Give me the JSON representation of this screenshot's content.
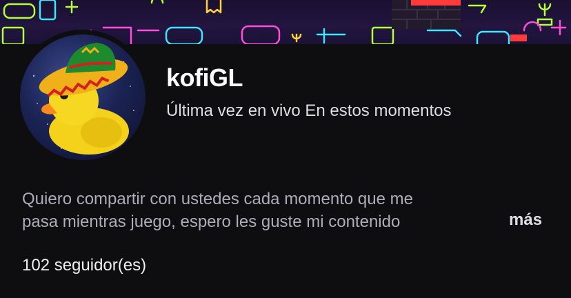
{
  "channel": {
    "name": "kofiGL",
    "last_live": "Última vez en vivo En estos momentos",
    "bio_line_1": "Quiero compartir con ustedes cada momento que me",
    "bio_line_2": "pasa mientras juego, espero les guste mi contenido",
    "more_label": "más",
    "followers": "102 seguidor(es)"
  },
  "banner": {
    "icons": [
      "gamepad-icon",
      "handheld-icon",
      "joystick-icon",
      "ghost-icon",
      "arcade-icon"
    ],
    "accent_colors": [
      "#ff4fd8",
      "#3ee6ff",
      "#b4ff3a",
      "#ffd23a"
    ]
  },
  "avatar": {
    "subject": "duck-with-sombrero"
  }
}
